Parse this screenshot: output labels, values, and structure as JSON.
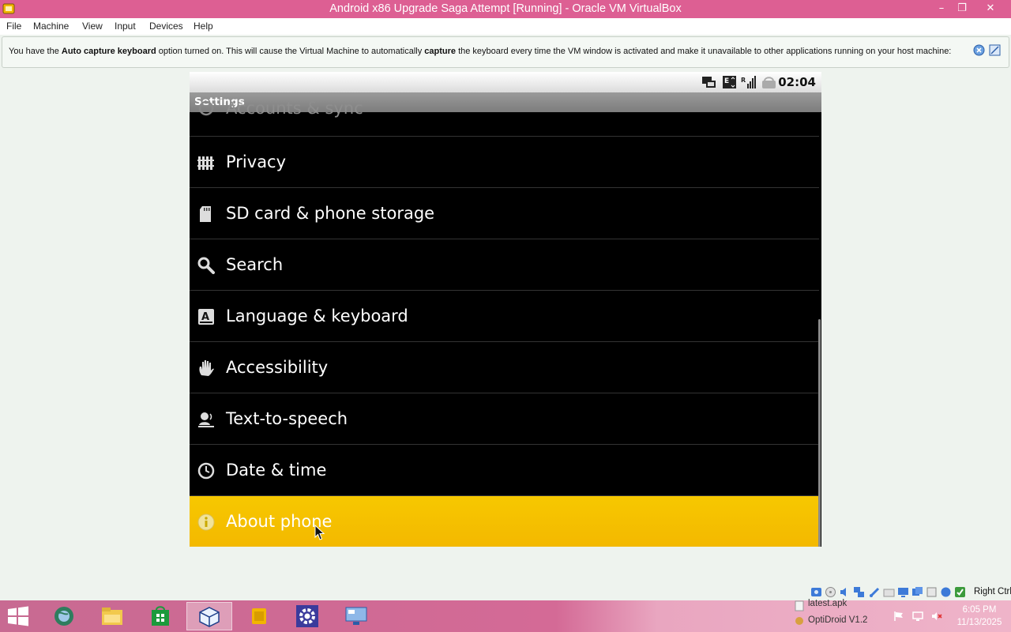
{
  "window": {
    "title": "Android x86 Upgrade Saga Attempt [Running] - Oracle VM VirtualBox",
    "controls": {
      "minimize": "–",
      "restore": "❐",
      "close": "✕"
    }
  },
  "menubar": [
    "File",
    "Machine",
    "View",
    "Input",
    "Devices",
    "Help"
  ],
  "notification": {
    "part1": "You have the ",
    "bold1": "Auto capture keyboard",
    "part2": " option turned on. This will cause the Virtual Machine to automatically ",
    "bold2": "capture",
    "part3": " the keyboard every time the VM window is activated and make it unavailable to other applications running on your host machine:"
  },
  "android": {
    "status_time": "02:04",
    "screen_title": "Settings",
    "partial_item": "Accounts & sync",
    "items": [
      {
        "label": "Privacy",
        "icon": "privacy-icon"
      },
      {
        "label": "SD card & phone storage",
        "icon": "sd-card-icon"
      },
      {
        "label": "Search",
        "icon": "search-icon"
      },
      {
        "label": "Language & keyboard",
        "icon": "language-icon"
      },
      {
        "label": "Accessibility",
        "icon": "hand-icon"
      },
      {
        "label": "Text-to-speech",
        "icon": "speech-icon"
      },
      {
        "label": "Date & time",
        "icon": "clock-icon"
      },
      {
        "label": "About phone",
        "icon": "info-icon",
        "highlighted": true
      }
    ],
    "highlight_color": "#f5c000"
  },
  "vbox_status": {
    "host_key": "Right Ctrl"
  },
  "taskbar": {
    "tray_items": [
      "latest.apk",
      "OptiDroid V1.2"
    ],
    "time": "6:05 PM",
    "date": "11/13/2025"
  }
}
